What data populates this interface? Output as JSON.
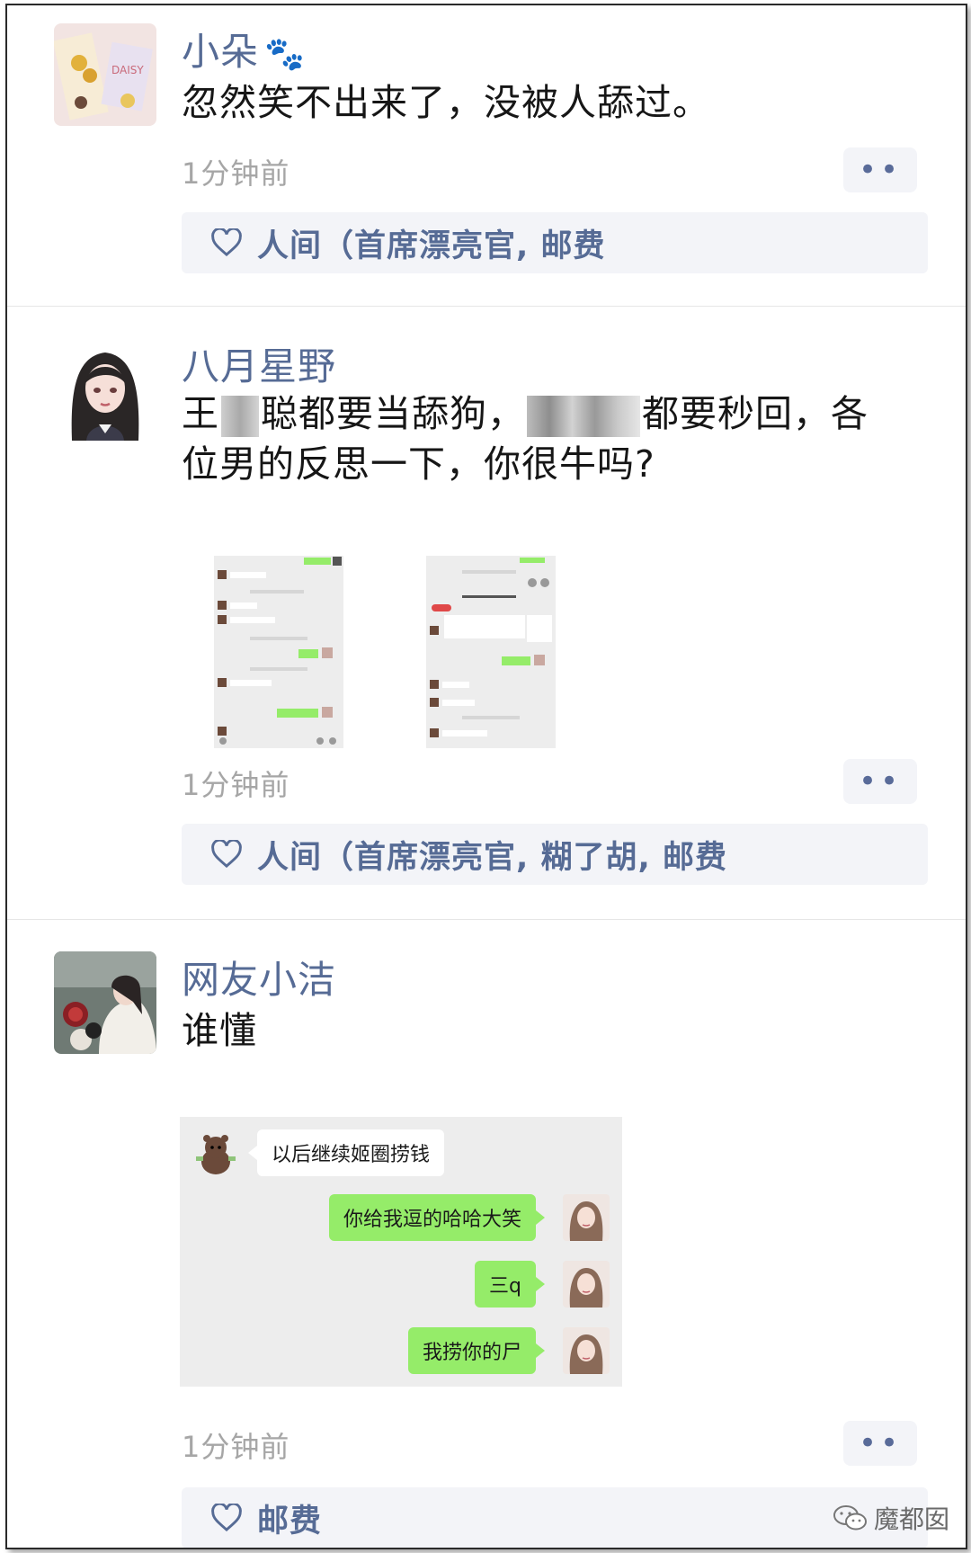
{
  "posts": [
    {
      "name": "小朵",
      "name_suffix_icon": "paw-print-icon",
      "text": "忽然笑不出来了，没被人舔过。",
      "time": "1分钟前",
      "more_label": "••",
      "likes": "人间（首席漂亮官, 邮费"
    },
    {
      "name": "八月星野",
      "text_line1_a": "王",
      "text_line1_b": "聪都要当舔狗，",
      "text_line1_c": "都要秒回，各",
      "text_line2": "位男的反思一下，你很牛吗?",
      "time": "1分钟前",
      "more_label": "••",
      "likes": "人间（首席漂亮官, 糊了胡, 邮费"
    },
    {
      "name": "网友小洁",
      "text": "谁懂",
      "chat": {
        "incoming": "以后继续姬圈捞钱",
        "outgoing": [
          "你给我逗的哈哈大笑",
          "三q",
          "我捞你的尸"
        ]
      },
      "time": "1分钟前",
      "more_label": "••",
      "likes": "邮费"
    }
  ],
  "watermark": "魔都囡",
  "colors": {
    "name_blue": "#566b95",
    "likes_bg": "#f3f4f8",
    "bubble_green": "#95ec69",
    "chat_bg": "#ededed"
  }
}
